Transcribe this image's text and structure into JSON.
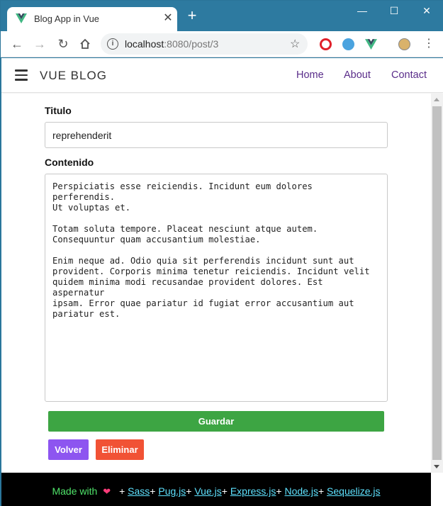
{
  "browser": {
    "tab_title": "Blog App in Vue",
    "tab_close": "✕",
    "new_tab": "+",
    "url_host": "localhost",
    "url_rest": ":8080/post/3",
    "controls": {
      "minimize": "—",
      "maximize": "☐",
      "close": "✕"
    }
  },
  "app": {
    "brand": "VUE BLOG",
    "nav": [
      {
        "label": "Home"
      },
      {
        "label": "About"
      },
      {
        "label": "Contact"
      }
    ]
  },
  "form": {
    "title_label": "Titulo",
    "title_value": "reprehenderit",
    "content_label": "Contenido",
    "content_value": "Perspiciatis esse reiciendis. Incidunt eum dolores perferendis.\nUt voluptas et.\n\nTotam soluta tempore. Placeat nesciunt atque autem.\nConsequuntur quam accusantium molestiae.\n\nEnim neque ad. Odio quia sit perferendis incidunt sunt aut\nprovident. Corporis minima tenetur reiciendis. Incidunt velit\nquidem minima modi recusandae provident dolores. Est aspernatur\nipsam. Error quae pariatur id fugiat error accusantium aut\npariatur est.",
    "save_label": "Guardar",
    "back_label": "Volver",
    "delete_label": "Eliminar"
  },
  "footer": {
    "made_with": "Made with",
    "links": [
      "Sass",
      "Pug.js",
      "Vue.js",
      "Express.js",
      "Node.js",
      "Sequelize.js"
    ]
  },
  "colors": {
    "save": "#3da543",
    "back": "#8d55f0",
    "delete": "#f15235",
    "nav_link": "#5a2d8a",
    "footer_text": "#4fe46a",
    "footer_link": "#5ee2ff"
  }
}
